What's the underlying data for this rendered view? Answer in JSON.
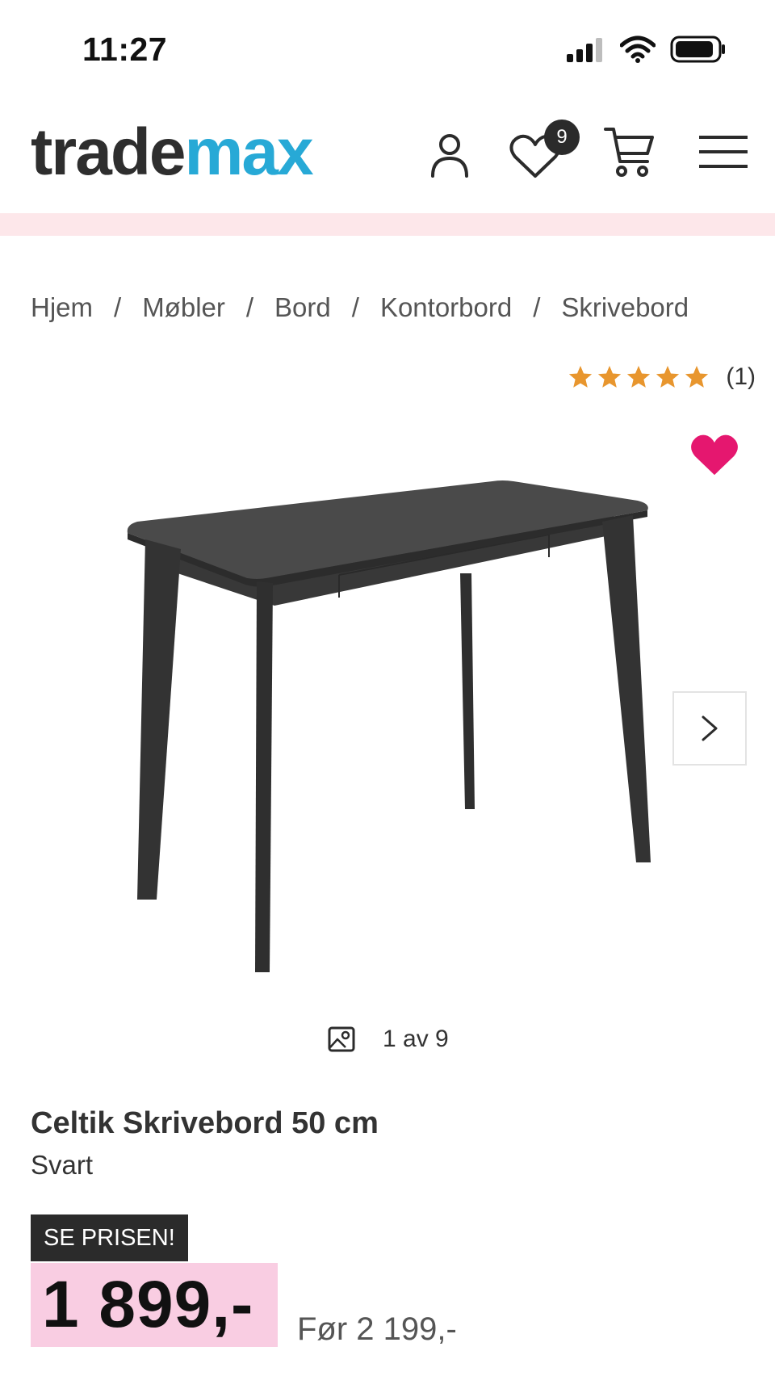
{
  "status_bar": {
    "time": "11:27"
  },
  "header": {
    "logo_part1": "trade",
    "logo_part2": "max",
    "wishlist_count": "9",
    "colors": {
      "logo_dark": "#2e2e2e",
      "logo_accent": "#27a9d6",
      "strip": "#fde7ea"
    }
  },
  "breadcrumb": {
    "items": [
      "Hjem",
      "Møbler",
      "Bord",
      "Kontorbord",
      "Skrivebord"
    ],
    "separator": "/"
  },
  "rating": {
    "stars": 5,
    "max": 5,
    "count": "(1)",
    "color": "#e8962e"
  },
  "gallery": {
    "counter": "1 av 9"
  },
  "product": {
    "title": "Celtik Skrivebord 50 cm",
    "variant": "Svart",
    "price_tag": "SE PRISEN!",
    "price": "1 899,-",
    "old_price": "Før 2 199,-",
    "colors": {
      "price_bg": "#f9cde2",
      "heart": "#e5176f"
    }
  },
  "icons": [
    "signal-icon",
    "wifi-icon",
    "battery-icon",
    "account-icon",
    "wishlist-icon",
    "cart-icon",
    "menu-icon",
    "favorite-heart-icon",
    "chevron-right-icon",
    "image-icon",
    "star-icon"
  ]
}
